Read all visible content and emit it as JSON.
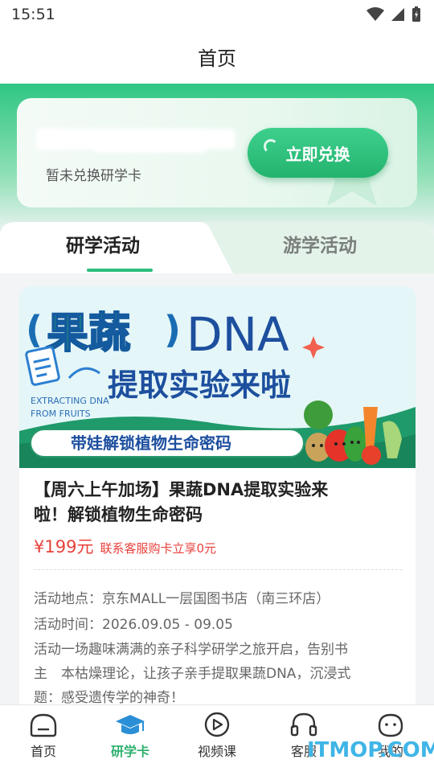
{
  "status_bar": {
    "time": "15:51"
  },
  "header": {
    "title": "首页"
  },
  "exchange_card": {
    "status": "暂未兑换研学卡",
    "redeem_label": "立即兑换"
  },
  "tabs": [
    {
      "label": "研学活动"
    },
    {
      "label": "游学活动"
    }
  ],
  "activity": {
    "banner": {
      "title_cn": "果蔬",
      "title_en": "DNA",
      "subtitle": "提取实验来啦",
      "english_line1": "EXTRACTING DNA",
      "english_line2": "FROM FRUITS",
      "slogan": "带娃解锁植物生命密码"
    },
    "title_line1": "【周六上午加场】果蔬DNA提取实验来",
    "title_line2": "啦！解锁植物生命密码",
    "price": "¥199元",
    "promo": "联系客服购卡立享0元",
    "location": "活动地点：京东MALL一层国图书店（南三环店）",
    "time": "活动时间：2026.09.05 - 09.05",
    "desc_line1": "活动一场趣味满满的亲子科学研学之旅开启，告别书",
    "desc_line2": "主　本枯燥理论，让孩子亲手提取果蔬DNA，沉浸式",
    "desc_line3": "题：感受遗传学的神奇！"
  },
  "nav": [
    {
      "label": "首页",
      "icon": "home-icon"
    },
    {
      "label": "研学卡",
      "icon": "graduation-cap-icon",
      "active": true
    },
    {
      "label": "视频课",
      "icon": "video-play-icon"
    },
    {
      "label": "客服",
      "icon": "headset-icon"
    },
    {
      "label": "我的",
      "icon": "profile-face-icon"
    }
  ],
  "watermark": "ITMOP.COM",
  "colors": {
    "brand_green": "#2bbd7a",
    "price_red": "#e8413c",
    "watermark_blue": "#3fb5e6"
  }
}
